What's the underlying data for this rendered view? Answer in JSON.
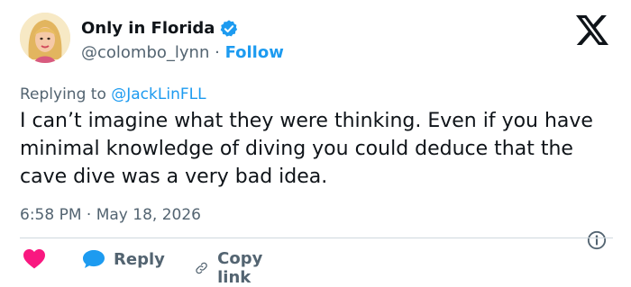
{
  "author": {
    "display_name": "Only in Florida",
    "handle": "@colombo_lynn",
    "separator": "·",
    "follow_label": "Follow",
    "verified": true
  },
  "tweet": {
    "reply_prefix": "Replying to",
    "reply_mention": "@JackLinFLL",
    "text": "I can’t imagine what they were thinking. Even if you have minimal knowledge of diving you could deduce that the cave dive was a very bad idea.",
    "time": "6:58 PM",
    "date_separator": "·",
    "date": "May 18, 2026"
  },
  "actions": {
    "reply_label": "Reply",
    "copy_link_label": "Copy link"
  },
  "icons": {
    "verified": "verified-badge-icon",
    "brand": "x-logo-icon",
    "info": "info-icon",
    "like": "heart-icon",
    "reply": "reply-bubble-icon",
    "copy": "link-icon"
  },
  "colors": {
    "accent": "#1d9bf0",
    "heart": "#f91880",
    "muted": "#536471",
    "text": "#0f1419"
  }
}
